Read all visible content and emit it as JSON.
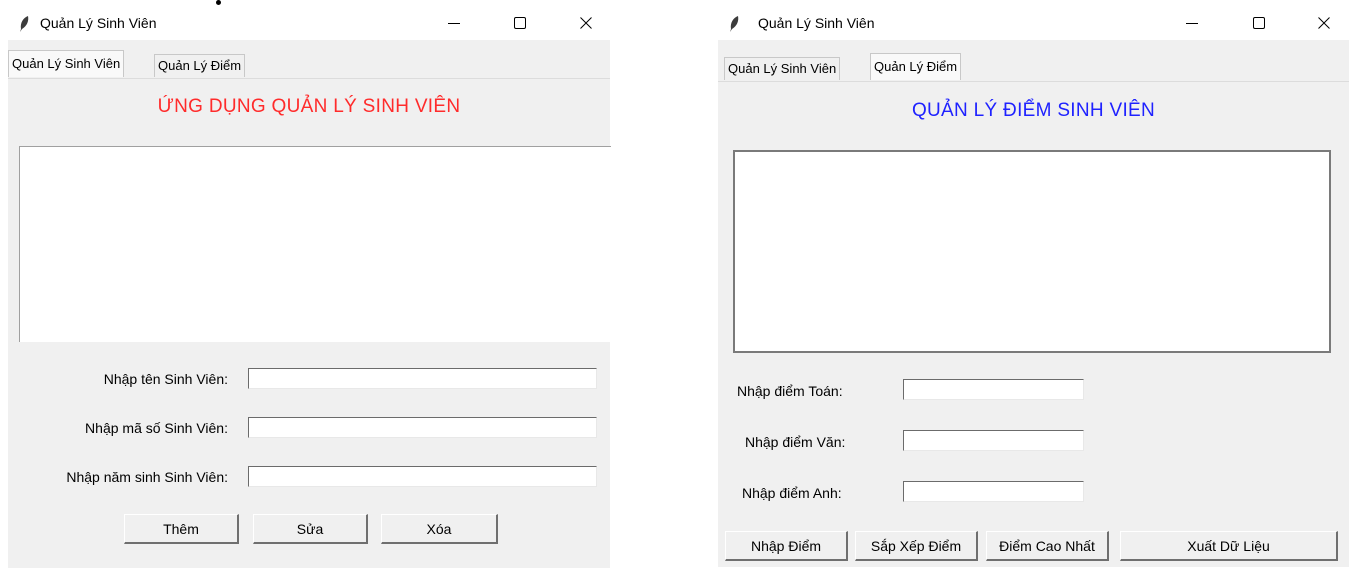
{
  "windows": [
    {
      "title": "Quản Lý Sinh Viên",
      "tabs": [
        "Quản Lý Sinh Viên",
        "Quản Lý Điểm"
      ],
      "active_tab": 0,
      "heading": "ỨNG DỤNG QUẢN LÝ SINH VIÊN",
      "heading_color": "#ff2b2b",
      "fields": [
        {
          "label": "Nhập tên Sinh Viên:",
          "value": ""
        },
        {
          "label": "Nhập mã số Sinh Viên:",
          "value": ""
        },
        {
          "label": "Nhập năm sinh Sinh Viên:",
          "value": ""
        }
      ],
      "buttons": [
        "Thêm",
        "Sửa",
        "Xóa"
      ]
    },
    {
      "title": "Quản Lý Sinh Viên",
      "tabs": [
        "Quản Lý Sinh Viên",
        "Quản Lý Điểm"
      ],
      "active_tab": 1,
      "heading": "QUẢN LÝ ĐIỂM SINH VIÊN",
      "heading_color": "#1f22ff",
      "fields": [
        {
          "label": "Nhập điểm Toán:",
          "value": ""
        },
        {
          "label": "Nhập điểm Văn:",
          "value": ""
        },
        {
          "label": "Nhập điểm Anh:",
          "value": ""
        }
      ],
      "buttons": [
        "Nhập Điểm",
        "Sắp Xếp Điểm",
        "Điểm Cao Nhất",
        "Xuất Dữ Liệu"
      ]
    }
  ],
  "icons": {
    "app": "feather-icon",
    "minimize": "minimize-icon",
    "maximize": "maximize-icon",
    "close": "close-icon"
  }
}
